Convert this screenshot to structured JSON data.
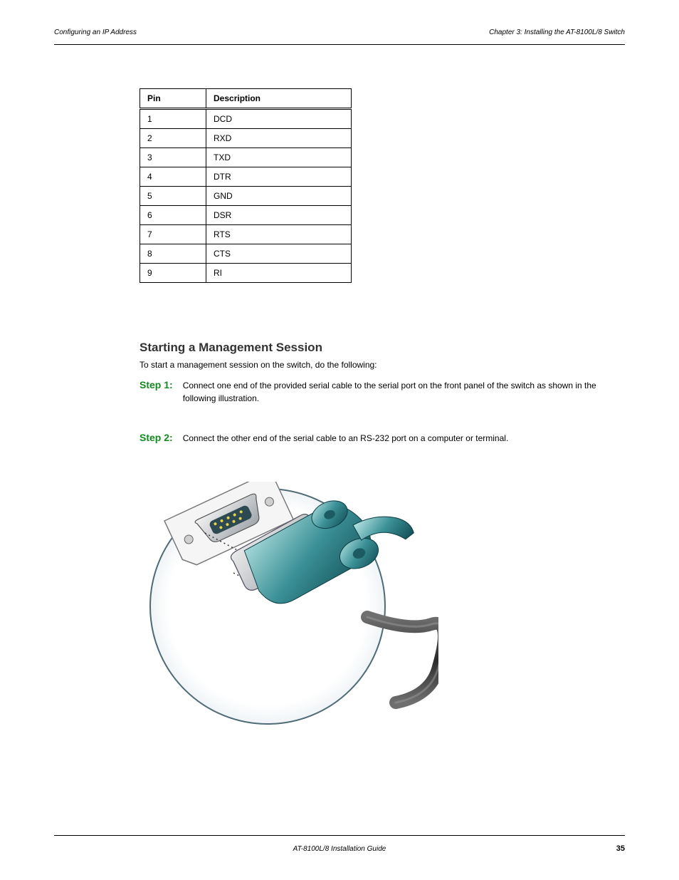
{
  "header": {
    "left": "Configuring an IP Address",
    "right": "Chapter 3: Installing the AT-8100L/8 Switch"
  },
  "table": {
    "columns": [
      "Pin",
      "Description"
    ],
    "rows": [
      {
        "pin": "1",
        "desc": "DCD"
      },
      {
        "pin": "2",
        "desc": "RXD"
      },
      {
        "pin": "3",
        "desc": "TXD"
      },
      {
        "pin": "4",
        "desc": "DTR"
      },
      {
        "pin": "5",
        "desc": "GND"
      },
      {
        "pin": "6",
        "desc": "DSR"
      },
      {
        "pin": "7",
        "desc": "RTS"
      },
      {
        "pin": "8",
        "desc": "CTS"
      },
      {
        "pin": "9",
        "desc": "RI"
      }
    ]
  },
  "section": {
    "title": "Starting a Management Session",
    "intro": "To start a management session on the switch, do the following:"
  },
  "steps": {
    "s1": {
      "label": "Step 1:",
      "text": "Connect one end of the provided serial cable to the serial port on the front panel of the switch as shown in the following illustration."
    },
    "s2": {
      "label": "Step 2:",
      "text": "Connect the other end of the serial cable to an RS-232 port on a computer or terminal."
    }
  },
  "footer": {
    "center": "AT-8100L/8 Installation Guide",
    "pagenum": "35"
  }
}
